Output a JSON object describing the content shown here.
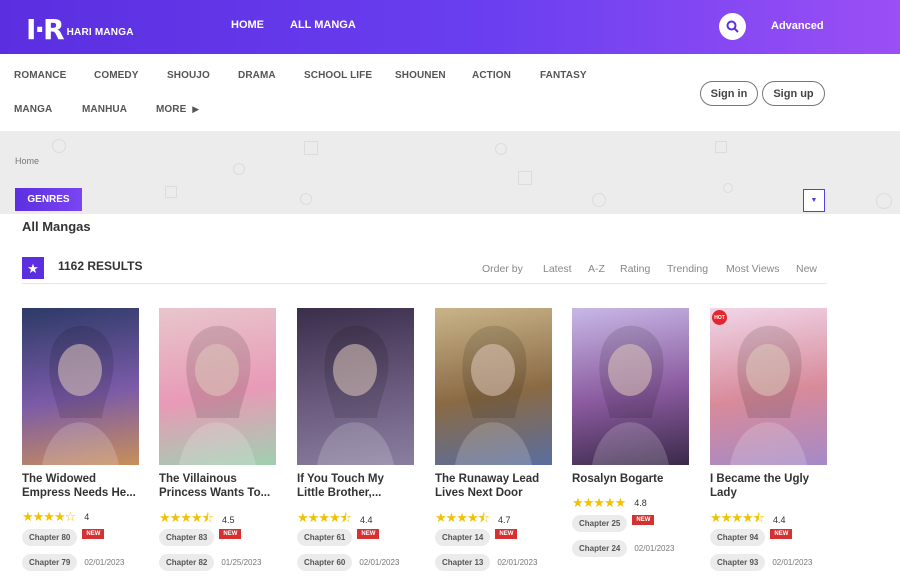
{
  "header": {
    "logo_mark": "I·R",
    "logo_text": "HARI MANGA",
    "nav": [
      "HOME",
      "ALL MANGA"
    ],
    "advanced_label": "Advanced"
  },
  "genre_nav": {
    "row1": [
      "ROMANCE",
      "COMEDY",
      "SHOUJO",
      "DRAMA",
      "SCHOOL LIFE",
      "SHOUNEN",
      "ACTION",
      "FANTASY"
    ],
    "row2": [
      "MANGA",
      "MANHUA",
      "MORE"
    ],
    "signin_label": "Sign in",
    "signup_label": "Sign up"
  },
  "breadcrumb": "Home",
  "genres_button": "GENRES",
  "page_title": "All Mangas",
  "results_label": "1162 RESULTS",
  "sort": {
    "label": "Order by",
    "options": [
      "Latest",
      "A-Z",
      "Rating",
      "Trending",
      "Most Views",
      "New"
    ]
  },
  "mangas": [
    {
      "title_line1": "The Widowed",
      "title_line2": "Empress Needs He...",
      "stars": "★★★★☆",
      "rating": "4",
      "chapters": [
        {
          "label": "Chapter 80",
          "new": "NEW",
          "date": ""
        },
        {
          "label": "Chapter 79",
          "new": "",
          "date": "02/01/2023"
        }
      ],
      "cover": {
        "top": "#2c3a66",
        "mid": "#7a5aa8",
        "bot": "#c98f5a"
      }
    },
    {
      "title_line1": "The Villainous",
      "title_line2": "Princess Wants To...",
      "stars": "★★★★⯪",
      "rating": "4.5",
      "chapters": [
        {
          "label": "Chapter 83",
          "new": "NEW",
          "date": ""
        },
        {
          "label": "Chapter 82",
          "new": "",
          "date": "01/25/2023"
        }
      ],
      "cover": {
        "top": "#e8c6cc",
        "mid": "#e89ab6",
        "bot": "#9fd0b0"
      }
    },
    {
      "title_line1": "If You Touch My",
      "title_line2": "Little Brother,...",
      "stars": "★★★★⯪",
      "rating": "4.4",
      "chapters": [
        {
          "label": "Chapter 61",
          "new": "NEW",
          "date": ""
        },
        {
          "label": "Chapter 60",
          "new": "",
          "date": "02/01/2023"
        }
      ],
      "cover": {
        "top": "#3a2e4a",
        "mid": "#6a5a7e",
        "bot": "#8a7fa0"
      }
    },
    {
      "title_line1": "The Runaway Lead",
      "title_line2": "Lives Next Door",
      "stars": "★★★★⯪",
      "rating": "4.7",
      "chapters": [
        {
          "label": "Chapter 14",
          "new": "NEW",
          "date": ""
        },
        {
          "label": "Chapter 13",
          "new": "",
          "date": "02/01/2023"
        }
      ],
      "cover": {
        "top": "#c9b48a",
        "mid": "#8a6a44",
        "bot": "#5a6ea0"
      }
    },
    {
      "title_line1": "Rosalyn Bogarte",
      "title_line2": "",
      "stars": "★★★★★",
      "rating": "4.8",
      "chapters": [
        {
          "label": "Chapter 25",
          "new": "NEW",
          "date": ""
        },
        {
          "label": "Chapter 24",
          "new": "",
          "date": "02/01/2023"
        }
      ],
      "cover": {
        "top": "#c8b8e6",
        "mid": "#8a5a9e",
        "bot": "#3a2a4a"
      }
    },
    {
      "title_line1": "I Became the Ugly",
      "title_line2": "Lady",
      "stars": "★★★★⯪",
      "rating": "4.4",
      "hot": "HOT",
      "chapters": [
        {
          "label": "Chapter 94",
          "new": "NEW",
          "date": ""
        },
        {
          "label": "Chapter 93",
          "new": "",
          "date": "02/01/2023"
        }
      ],
      "cover": {
        "top": "#f0d6e8",
        "mid": "#d88a9a",
        "bot": "#a48ac8"
      }
    }
  ],
  "colors": {
    "brand": "#5b2fe0",
    "star": "#f2c200",
    "new_badge": "#d63031"
  }
}
